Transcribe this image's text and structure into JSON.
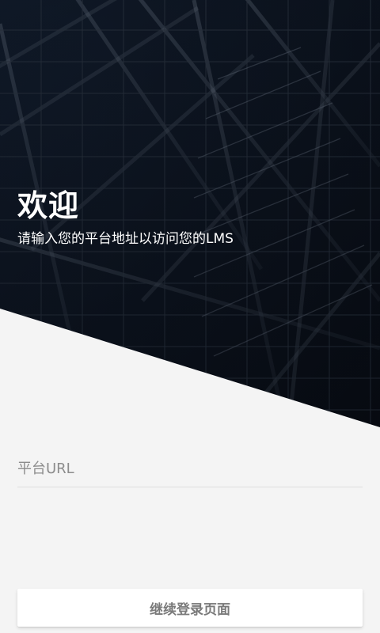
{
  "hero": {
    "background_colors": {
      "base": "#0b1119",
      "grid_light": "#5f6b7a",
      "grid_dark": "#27303b"
    }
  },
  "welcome": {
    "title": "欢迎",
    "subtitle": "请输入您的平台地址以访问您的LMS"
  },
  "form": {
    "platform_url": {
      "placeholder": "平台URL",
      "value": ""
    }
  },
  "actions": {
    "continue_label": "继续登录页面"
  },
  "colors": {
    "page_background": "#f4f4f4",
    "text_primary": "#ffffff",
    "text_secondary": "#7a7a7a",
    "divider": "#dddddd"
  }
}
